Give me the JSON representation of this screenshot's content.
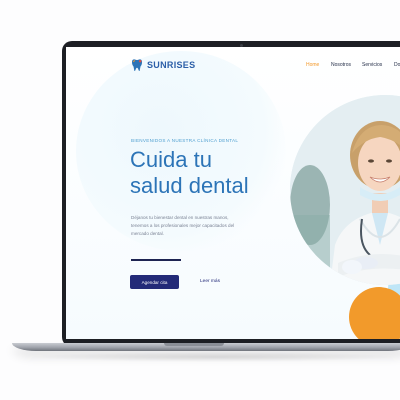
{
  "site": {
    "brand": "SUNRISES",
    "nav": {
      "items": [
        {
          "label": "Home",
          "active": true
        },
        {
          "label": "Nosotros",
          "active": false
        },
        {
          "label": "Servicios",
          "active": false
        },
        {
          "label": "Do",
          "active": false
        }
      ]
    },
    "hero": {
      "eyebrow": "BIENVENIDOS A NUESTRA CLÍNICA DENTAL",
      "title_line1": "Cuida tu",
      "title_line2": "salud dental",
      "description": "Déjanos tu bienestar dental en nuestras manos, tenemos a los profesionales mejor capacitados del mercado dental.",
      "primary_button": "Agendar cita",
      "secondary_link": "Leer más"
    }
  },
  "icons": {
    "logo": "tooth-logo-icon",
    "photo": "dentist-photo"
  },
  "colors": {
    "brand_blue": "#2c74b7",
    "nav_active": "#f39a2c",
    "button_bg": "#232a78",
    "accent_orange": "#f29a2b",
    "accent_light_blue": "#bfe6f7",
    "laptop_frame": "#1d1f24"
  }
}
